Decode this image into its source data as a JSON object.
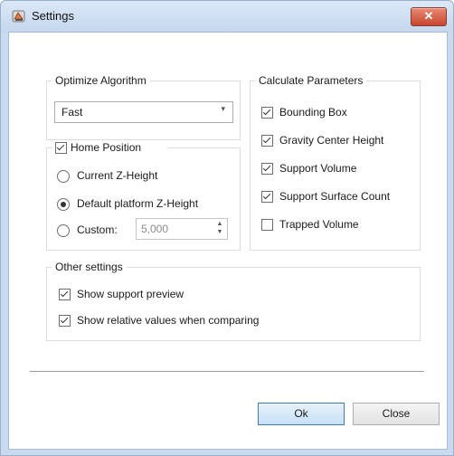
{
  "window": {
    "title": "Settings",
    "close_symbol": "✕"
  },
  "optimize": {
    "legend": "Optimize Algorithm",
    "selected": "Fast"
  },
  "home": {
    "legend": "Home Position",
    "checked": true,
    "options": [
      {
        "label": "Current Z-Height",
        "selected": false
      },
      {
        "label": "Default platform Z-Height",
        "selected": true
      },
      {
        "label": "Custom:",
        "selected": false
      }
    ],
    "custom_value": "5,000"
  },
  "calculate": {
    "legend": "Calculate Parameters",
    "items": [
      {
        "label": "Bounding Box",
        "checked": true
      },
      {
        "label": "Gravity Center Height",
        "checked": true
      },
      {
        "label": "Support Volume",
        "checked": true
      },
      {
        "label": "Support Surface Count",
        "checked": true
      },
      {
        "label": "Trapped Volume",
        "checked": false
      }
    ]
  },
  "other": {
    "legend": "Other settings",
    "items": [
      {
        "label": "Show support preview",
        "checked": true
      },
      {
        "label": "Show relative values when comparing",
        "checked": true
      }
    ]
  },
  "buttons": {
    "ok": "Ok",
    "close": "Close"
  },
  "colors": {
    "title_gradient_top": "#dbe8f7",
    "close_button": "#c9452c",
    "primary_button_border": "#3c7fb1"
  }
}
